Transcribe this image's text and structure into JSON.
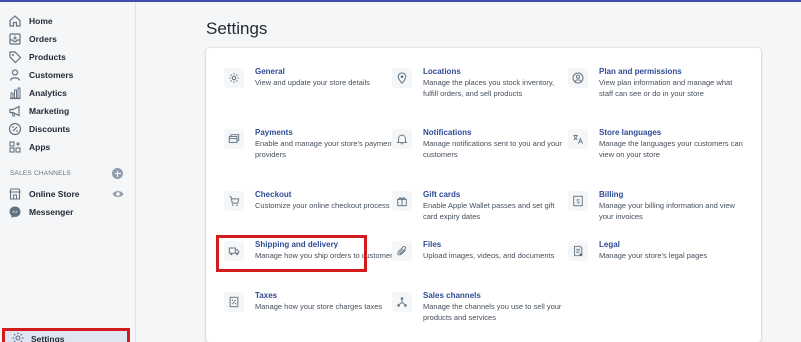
{
  "sidebar": {
    "items": [
      {
        "label": "Home",
        "icon": "home-icon"
      },
      {
        "label": "Orders",
        "icon": "orders-icon"
      },
      {
        "label": "Products",
        "icon": "tag-icon"
      },
      {
        "label": "Customers",
        "icon": "person-icon"
      },
      {
        "label": "Analytics",
        "icon": "bar-chart-icon"
      },
      {
        "label": "Marketing",
        "icon": "megaphone-icon"
      },
      {
        "label": "Discounts",
        "icon": "discount-icon"
      },
      {
        "label": "Apps",
        "icon": "apps-icon"
      }
    ],
    "sales_channels_heading": "SALES CHANNELS",
    "channels": [
      {
        "label": "Online Store",
        "icon": "store-icon"
      },
      {
        "label": "Messenger",
        "icon": "messenger-icon"
      }
    ],
    "settings_label": "Settings"
  },
  "page": {
    "title": "Settings"
  },
  "tiles": [
    {
      "title": "General",
      "desc": "View and update your store details",
      "icon": "gear-icon"
    },
    {
      "title": "Locations",
      "desc": "Manage the places you stock inventory, fulfill orders, and sell products",
      "icon": "location-pin-icon"
    },
    {
      "title": "Plan and permissions",
      "desc": "View plan information and manage what staff can see or do in your store",
      "icon": "user-circle-icon"
    },
    {
      "title": "Payments",
      "desc": "Enable and manage your store's payment providers",
      "icon": "payment-icon"
    },
    {
      "title": "Notifications",
      "desc": "Manage notifications sent to you and your customers",
      "icon": "bell-icon"
    },
    {
      "title": "Store languages",
      "desc": "Manage the languages your customers can view on your store",
      "icon": "language-icon"
    },
    {
      "title": "Checkout",
      "desc": "Customize your online checkout process",
      "icon": "cart-icon"
    },
    {
      "title": "Gift cards",
      "desc": "Enable Apple Wallet passes and set gift card expiry dates",
      "icon": "gift-icon"
    },
    {
      "title": "Billing",
      "desc": "Manage your billing information and view your invoices",
      "icon": "billing-icon"
    },
    {
      "title": "Shipping and delivery",
      "desc": "Manage how you ship orders to customers",
      "icon": "truck-icon"
    },
    {
      "title": "Files",
      "desc": "Upload images, videos, and documents",
      "icon": "paperclip-icon"
    },
    {
      "title": "Legal",
      "desc": "Manage your store's legal pages",
      "icon": "legal-document-icon"
    },
    {
      "title": "Taxes",
      "desc": "Manage how your store charges taxes",
      "icon": "tax-icon"
    },
    {
      "title": "Sales channels",
      "desc": "Manage the channels you use to sell your products and services",
      "icon": "sales-channels-icon"
    }
  ],
  "colors": {
    "accent": "#2f4b94",
    "highlight": "#d21b1b",
    "icon": "#637381",
    "topbar": "#3f4eae"
  }
}
